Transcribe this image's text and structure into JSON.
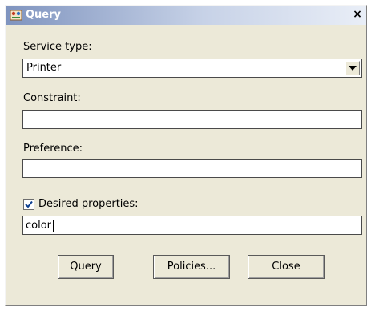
{
  "window": {
    "title": "Query",
    "close_glyph": "×"
  },
  "service_type": {
    "label": "Service type:",
    "value": "Printer"
  },
  "constraint": {
    "label": "Constraint:",
    "value": ""
  },
  "preference": {
    "label": "Preference:",
    "value": ""
  },
  "desired_properties": {
    "label": "Desired properties:",
    "checked": true,
    "value": "color"
  },
  "buttons": {
    "query": "Query",
    "policies": "Policies...",
    "close": "Close"
  },
  "icons": {
    "window_icon": "app-icon",
    "dropdown": "chevron-down-icon",
    "check": "check-icon"
  }
}
